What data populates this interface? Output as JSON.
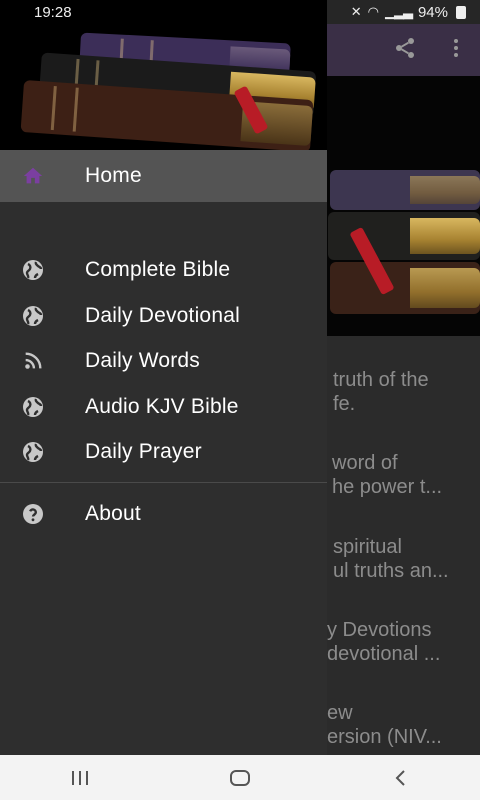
{
  "status_bar": {
    "time": "19:28",
    "battery": "94%"
  },
  "background_app": {
    "visible_text": [
      {
        "l1": "truth of the",
        "l2": "fe."
      },
      {
        "l1": "word of",
        "l2": "he power t..."
      },
      {
        "l1": "spiritual",
        "l2": "ul truths an..."
      },
      {
        "l1": "y Devotions",
        "l2": "devotional ..."
      },
      {
        "l1": "ew",
        "l2": "ersion (NIV..."
      }
    ]
  },
  "drawer": {
    "items": [
      {
        "label": "Home",
        "icon": "home-icon",
        "active": true
      },
      {
        "label": "Complete Bible",
        "icon": "globe-icon"
      },
      {
        "label": "Daily Devotional",
        "icon": "globe-icon"
      },
      {
        "label": "Daily Words",
        "icon": "rss-icon"
      },
      {
        "label": "Audio KJV Bible",
        "icon": "globe-icon"
      },
      {
        "label": "Daily Prayer",
        "icon": "globe-icon"
      },
      {
        "label": "About",
        "icon": "help-icon"
      }
    ]
  },
  "colors": {
    "accent": "#7b3fa0",
    "drawer_bg": "#2e2e2e",
    "active_row": "#545454",
    "toolbar": "#3a2f46"
  }
}
